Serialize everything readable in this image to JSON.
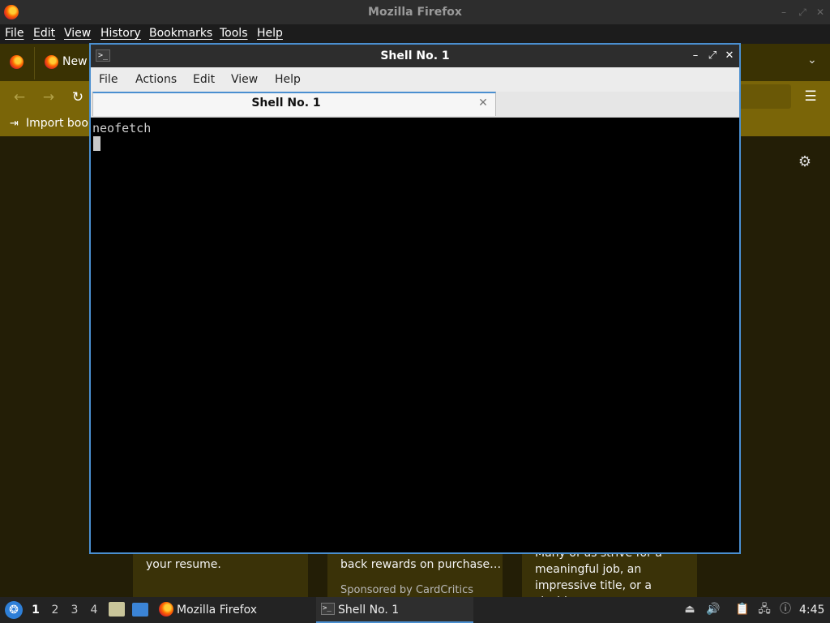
{
  "firefox": {
    "window_title": "Mozilla Firefox",
    "menu": [
      "File",
      "Edit",
      "View",
      "History",
      "Bookmarks",
      "Tools",
      "Help"
    ],
    "tab_label": "New",
    "import_bookmarks": "Import book",
    "cards": [
      {
        "line1": "your resume.",
        "line2": ""
      },
      {
        "line1": "back rewards on purchase…",
        "sponsor": "Sponsored by CardCritics"
      },
      {
        "line1": "Many of us strive for a",
        "line2": "meaningful job, an",
        "line3": "impressive title, or a sizabl…"
      }
    ]
  },
  "terminal": {
    "title": "Shell No. 1",
    "menu": [
      "File",
      "Actions",
      "Edit",
      "View",
      "Help"
    ],
    "tab_label": "Shell No. 1",
    "command_line": "neofetch"
  },
  "taskbar": {
    "workspaces": [
      "1",
      "2",
      "3",
      "4"
    ],
    "active_workspace": "1",
    "firefox_label": "Mozilla Firefox",
    "shell_label": "Shell No. 1",
    "clock": "4:45"
  },
  "colors": {
    "accent_blue": "#4a8fd0",
    "firefox_toolbar": "#7a6508",
    "terminal_bg": "#000000"
  },
  "icons": [
    "firefox-icon",
    "terminal-icon",
    "gear-icon",
    "hamburger-icon",
    "back-arrow-icon",
    "forward-arrow-icon",
    "reload-icon",
    "close-icon",
    "minimize-icon",
    "maximize-icon",
    "chevron-down-icon",
    "volume-icon",
    "network-icon",
    "notification-icon",
    "clipboard-icon"
  ]
}
